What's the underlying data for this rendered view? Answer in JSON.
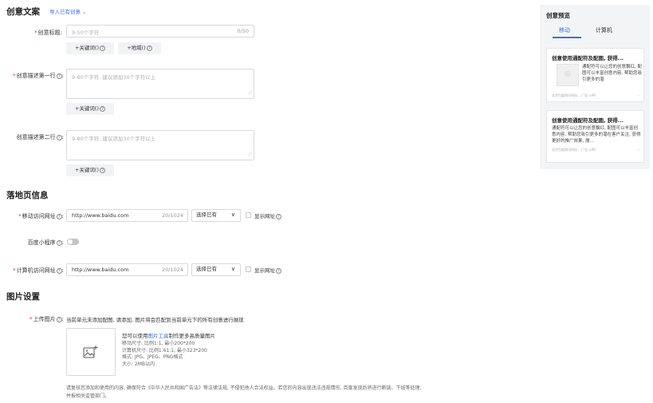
{
  "creative": {
    "title": "创意文案",
    "import_label": "导入已有创意",
    "title_field": {
      "label": "创意标题:",
      "placeholder": "9-50个字符",
      "counter": "0/50"
    },
    "keyword_button": "+关键词()",
    "region_button": "+地域()",
    "desc1": {
      "label": "创意描述第一行",
      "placeholder": "9-80个字符, 建议添加30个字符以上"
    },
    "desc2": {
      "label": "创意描述第二行",
      "placeholder": "9-80个字符, 建议添加30个字符以上"
    }
  },
  "landing": {
    "title": "落地页信息",
    "mobile": {
      "label": "移动访问网址",
      "value": "http://www.baidu.com",
      "counter": "20/1024",
      "select": "选择已有",
      "show_label": "显示网址"
    },
    "mini_program_label": "百度小程序",
    "pc": {
      "label": "计算机访问网址",
      "value": "http://www.baidu.com",
      "counter": "20/1024",
      "select": "选择已有",
      "show_label": "显示网址"
    }
  },
  "image": {
    "title": "图片设置",
    "upload_label": "上传图片",
    "upload_hint": "当前单元未添加配图, 请添加, 图片将会匹配到当前单元下的所有创意进行展现",
    "tool_prefix": "您可以使用",
    "tool_link": "图片工具",
    "tool_suffix": "制作更多高质量图片",
    "spec_mobile": "移动尺寸: 比例1:1, 最小200*200",
    "spec_pc": "计算机尺寸: 比例1.61:1, 最小323*200",
    "spec_format": "格式: JPG、JPEG、PNG格式",
    "spec_size": "大小: 2MB以内",
    "notice_line1": "请复核您添加和使用的内容, 确保符合《中华人民共和国广告法》等法律法规, 不侵犯他人合法权益。若您的内容出现违法违规情形, 百度发现后将进行断链、下线等处理,",
    "notice_line2": "并报相关监管部门。"
  },
  "preview": {
    "title": "创意预览",
    "tabs": [
      "移动",
      "计算机"
    ],
    "active_tab": 0,
    "card1": {
      "title": "创意使用通配符及配图, 获得...",
      "body": "通配符可以让您的创意飘红, 配图可以丰富创意内容, 帮助您吸引更多的潜",
      "footer": "北京百度网讯科技...   广告 ◎99"
    },
    "card2": {
      "title": "创意使用通配符及配图, 获得...",
      "body": "通配符可以让您的创意飘红, 配图可以丰富创意内容, 帮助您吸引更多的潜在客户关注, 获得更好的推广效果, 搜...",
      "footer": "北京百度网讯科技...   广告 ◎99"
    }
  },
  "colors": {
    "accent": "#3a6ee8",
    "required": "#f5222d",
    "panel_bg": "#f3f4f6"
  }
}
